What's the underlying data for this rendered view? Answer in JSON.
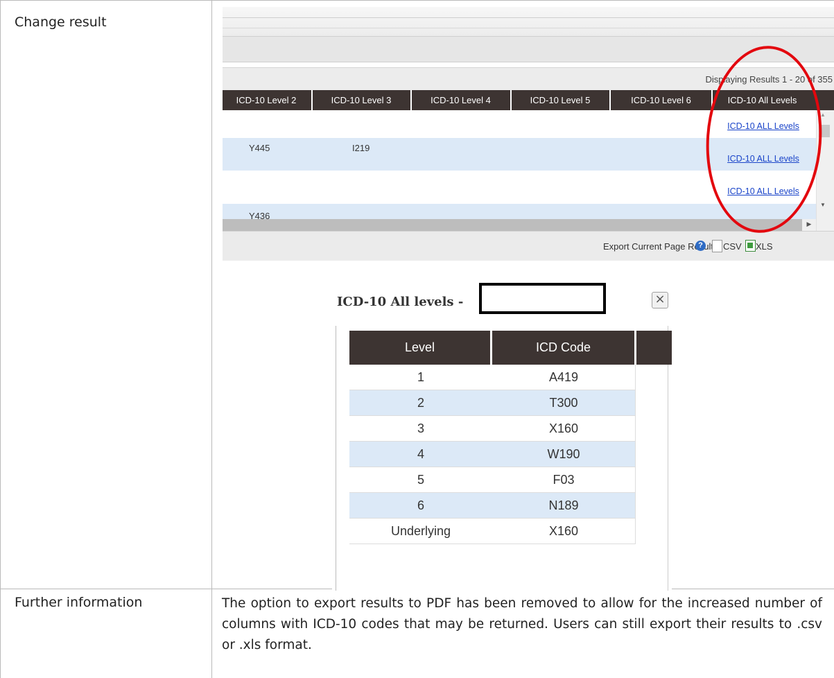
{
  "rows": {
    "change_result": "Change result",
    "further_information": "Further information"
  },
  "further_text": "The option to export results to PDF has been removed to allow for the increased number of columns with ICD-10 codes that may be returned. Users can still export their results to .csv or .xls format.",
  "results_grid": {
    "pager_text": "Displaying Results 1 - 20 of 355",
    "columns": [
      "ICD-10 Level 2",
      "ICD-10 Level 3",
      "ICD-10 Level 4",
      "ICD-10 Level 5",
      "ICD-10 Level 6",
      "ICD-10 All Levels"
    ],
    "rows": [
      {
        "level2": "",
        "level3": "",
        "link": "ICD-10 ALL Levels"
      },
      {
        "level2": "Y445",
        "level3": "I219",
        "link": "ICD-10 ALL Levels"
      },
      {
        "level2": "",
        "level3": "",
        "link": "ICD-10 ALL Levels"
      },
      {
        "level2": "Y436",
        "level3": "",
        "link": ""
      }
    ],
    "export_label": "Export Current Page Results:",
    "csv_label": "CSV",
    "xls_label": "XLS"
  },
  "dialog": {
    "title": "ICD-10 All levels -",
    "close_symbol": "×",
    "headers": [
      "Level",
      "ICD Code"
    ],
    "rows": [
      {
        "level": "1",
        "code": "A419"
      },
      {
        "level": "2",
        "code": "T300"
      },
      {
        "level": "3",
        "code": "X160"
      },
      {
        "level": "4",
        "code": "W190"
      },
      {
        "level": "5",
        "code": "F03"
      },
      {
        "level": "6",
        "code": "N189"
      },
      {
        "level": "Underlying",
        "code": "X160"
      }
    ]
  },
  "colors": {
    "header_bg": "#3d3432",
    "alt_row": "#dce9f7",
    "link": "#1a44c9",
    "highlight_ring": "#e3070e"
  }
}
